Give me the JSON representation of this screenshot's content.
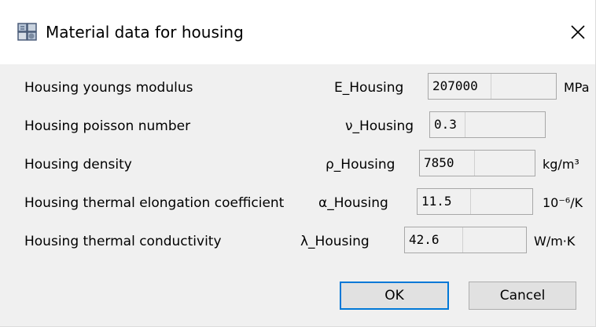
{
  "window": {
    "title": "Material data for housing",
    "close_glyph": "✕"
  },
  "rows": [
    {
      "label": "Housing youngs modulus",
      "symbol": "E_Housing",
      "value": "207000",
      "unit": "MPa"
    },
    {
      "label": "Housing poisson number",
      "symbol": "ν_Housing",
      "value": "0.3",
      "unit": ""
    },
    {
      "label": "Housing density",
      "symbol": "ρ_Housing",
      "value": "7850",
      "unit": "kg/m³"
    },
    {
      "label": "Housing thermal elongation coefficient",
      "symbol": "α_Housing",
      "value": "11.5",
      "unit": "10⁻⁶/K"
    },
    {
      "label": "Housing thermal conductivity",
      "symbol": "λ_Housing",
      "value": "42.6",
      "unit": "W/m·K"
    }
  ],
  "buttons": {
    "ok": "OK",
    "cancel": "Cancel"
  }
}
